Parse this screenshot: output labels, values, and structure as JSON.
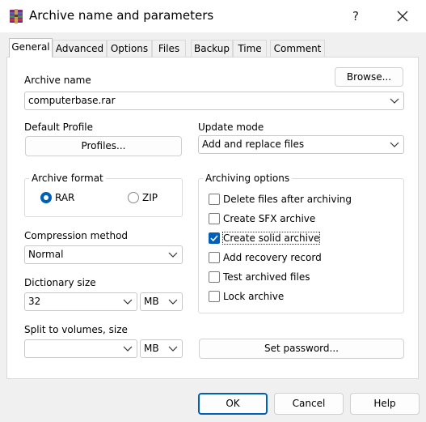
{
  "window": {
    "title": "Archive name and parameters",
    "help_glyph": "?",
    "accent_color": "#005fb8"
  },
  "tabs": [
    {
      "label": "General",
      "active": true
    },
    {
      "label": "Advanced",
      "active": false
    },
    {
      "label": "Options",
      "active": false
    },
    {
      "label": "Files",
      "active": false
    },
    {
      "label": "Backup",
      "active": false
    },
    {
      "label": "Time",
      "active": false
    },
    {
      "label": "Comment",
      "active": false
    }
  ],
  "general": {
    "archive_name_label": "Archive name",
    "archive_name_value": "computerbase.rar",
    "browse_label": "Browse...",
    "default_profile_label": "Default Profile",
    "profiles_label": "Profiles...",
    "update_mode_label": "Update mode",
    "update_mode_value": "Add and replace files",
    "archive_format_label": "Archive format",
    "format_options": [
      {
        "label": "RAR",
        "selected": true
      },
      {
        "label": "ZIP",
        "selected": false
      }
    ],
    "compression_method_label": "Compression method",
    "compression_method_value": "Normal",
    "dictionary_size_label": "Dictionary size",
    "dictionary_size_value": "32",
    "dictionary_unit": "MB",
    "split_volumes_label": "Split to volumes, size",
    "split_volumes_value": "",
    "split_unit": "MB",
    "set_password_label": "Set password...",
    "archiving_options_label": "Archiving options",
    "archiving_options": [
      {
        "label": "Delete files after archiving",
        "checked": false
      },
      {
        "label": "Create SFX archive",
        "checked": false
      },
      {
        "label": "Create solid archive",
        "checked": true
      },
      {
        "label": "Add recovery record",
        "checked": false
      },
      {
        "label": "Test archived files",
        "checked": false
      },
      {
        "label": "Lock archive",
        "checked": false
      }
    ]
  },
  "footer": {
    "ok_label": "OK",
    "cancel_label": "Cancel",
    "help_label": "Help"
  }
}
